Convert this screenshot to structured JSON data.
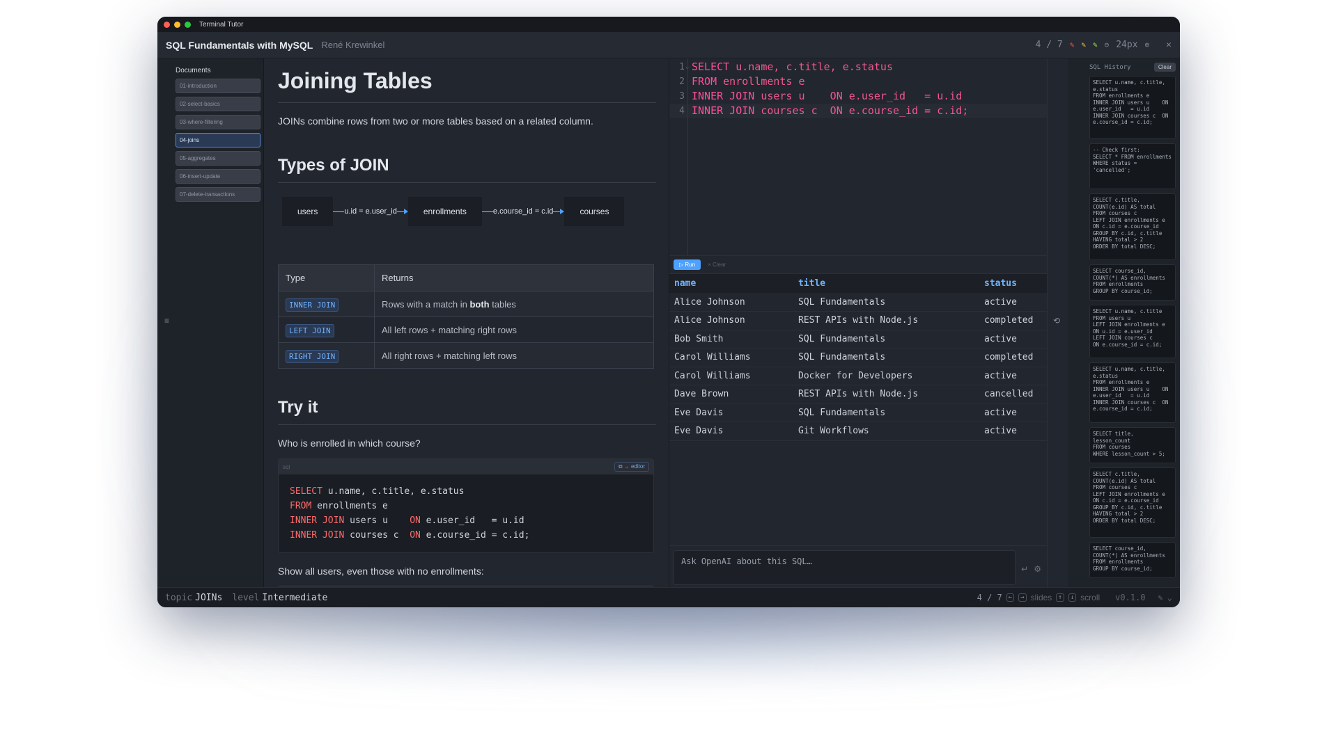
{
  "window": {
    "app_name": "Terminal Tutor"
  },
  "header": {
    "course": "SQL Fundamentals with MySQL",
    "author": "René Krewinkel",
    "page": "4 / 7",
    "font_size": "24px",
    "close": "✕",
    "pen_colors": [
      "#ff5555",
      "#f0c040",
      "#a8e040"
    ]
  },
  "sidebar": {
    "title": "Documents",
    "items": [
      {
        "label": "01-introduction"
      },
      {
        "label": "02-select-basics"
      },
      {
        "label": "03-where-filtering"
      },
      {
        "label": "04-joins"
      },
      {
        "label": "05-aggregates"
      },
      {
        "label": "06-insert-update"
      },
      {
        "label": "07-delete-transactions"
      }
    ]
  },
  "doc": {
    "title": "Joining Tables",
    "intro": "JOINs combine rows from two or more tables based on a related column.",
    "types_heading": "Types of JOIN",
    "diagram": {
      "nodes": [
        "users",
        "enrollments",
        "courses"
      ],
      "edges": [
        "u.id = e.user_id",
        "e.course_id = c.id"
      ]
    },
    "table": {
      "headers": [
        "Type",
        "Returns"
      ],
      "rows": [
        {
          "type": "INNER JOIN",
          "returns_pre": "Rows with a match in ",
          "returns_bold": "both",
          "returns_post": " tables"
        },
        {
          "type": "LEFT JOIN",
          "returns_pre": "All left rows + matching right rows",
          "returns_bold": "",
          "returns_post": ""
        },
        {
          "type": "RIGHT JOIN",
          "returns_pre": "All right rows + matching left rows",
          "returns_bold": "",
          "returns_post": ""
        }
      ]
    },
    "try_heading": "Try it",
    "question1": "Who is enrolled in which course?",
    "code_lang": "sql",
    "to_editor": "⧉ → editor",
    "code": {
      "l1_kw": "SELECT",
      "l1_rest": " u.name, c.title, e.status",
      "l2_kw": "FROM",
      "l2_rest": " enrollments e",
      "l3_kw": "INNER JOIN",
      "l3_mid": " users u    ",
      "l3_kw2": "ON",
      "l3_rest": " e.user_id   = u.id",
      "l4_kw": "INNER JOIN",
      "l4_mid": " courses c  ",
      "l4_kw2": "ON",
      "l4_rest": " e.course_id = c.id;"
    },
    "question2": "Show all users, even those with no enrollments:"
  },
  "editor": {
    "lines": [
      {
        "n": "1",
        "fold": "⌄",
        "kw": "SELECT",
        "rest": " u.name, c.title, e.status"
      },
      {
        "n": "2",
        "fold": "",
        "kw": "FROM",
        "rest": " enrollments e"
      },
      {
        "n": "3",
        "fold": "",
        "kw": "INNER JOIN",
        "rest": " users u    ON e.user_id   = u.id"
      },
      {
        "n": "4",
        "fold": "",
        "kw": "INNER JOIN",
        "rest": " courses c  ON e.course_id = c.id;"
      }
    ],
    "run_label": "▷ Run",
    "clear_label": "× Clear"
  },
  "results": {
    "columns": [
      "name",
      "title",
      "status"
    ],
    "rows": [
      [
        "Alice Johnson",
        "SQL Fundamentals",
        "active"
      ],
      [
        "Alice Johnson",
        "REST APIs with Node.js",
        "completed"
      ],
      [
        "Bob Smith",
        "SQL Fundamentals",
        "active"
      ],
      [
        "Carol Williams",
        "SQL Fundamentals",
        "completed"
      ],
      [
        "Carol Williams",
        "Docker for Developers",
        "active"
      ],
      [
        "Dave Brown",
        "REST APIs with Node.js",
        "cancelled"
      ],
      [
        "Eve Davis",
        "SQL Fundamentals",
        "active"
      ],
      [
        "Eve Davis",
        "Git Workflows",
        "active"
      ]
    ]
  },
  "ai": {
    "placeholder": "Ask OpenAI about this SQL…"
  },
  "history": {
    "title": "SQL History",
    "clear_label": "Clear",
    "items": [
      "SELECT u.name, c.title,\ne.status\nFROM enrollments e\nINNER JOIN users u    ON\ne.user_id   = u.id\nINNER JOIN courses c  ON\ne.course_id = c.id;",
      "-- Check first:\nSELECT * FROM enrollments\nWHERE status =\n'cancelled';",
      "SELECT c.title,\nCOUNT(e.id) AS total\nFROM courses c\nLEFT JOIN enrollments e\nON c.id = e.course_id\nGROUP BY c.id, c.title\nHAVING total > 2\nORDER BY total DESC;",
      "SELECT course_id,\nCOUNT(*) AS enrollments\nFROM enrollments\nGROUP BY course_id;",
      "SELECT u.name, c.title\nFROM users u\nLEFT JOIN enrollments e\nON u.id = e.user_id\nLEFT JOIN courses c\nON e.course_id = c.id;",
      "SELECT u.name, c.title,\ne.status\nFROM enrollments e\nINNER JOIN users u    ON\ne.user_id   = u.id\nINNER JOIN courses c  ON\ne.course_id = c.id;",
      "SELECT title,\nlesson_count\nFROM courses\nWHERE lesson_count > 5;",
      "SELECT c.title,\nCOUNT(e.id) AS total\nFROM courses c\nLEFT JOIN enrollments e\nON c.id = e.course_id\nGROUP BY c.id, c.title\nHAVING total > 2\nORDER BY total DESC;",
      "SELECT course_id,\nCOUNT(*) AS enrollments\nFROM enrollments\nGROUP BY course_id;"
    ]
  },
  "status": {
    "topic_key": "topic",
    "topic_val": "JOINs",
    "level_key": "level",
    "level_val": "Intermediate",
    "page": "4 / 7",
    "slides": "slides",
    "scroll": "scroll",
    "version": "v0.1.0"
  }
}
